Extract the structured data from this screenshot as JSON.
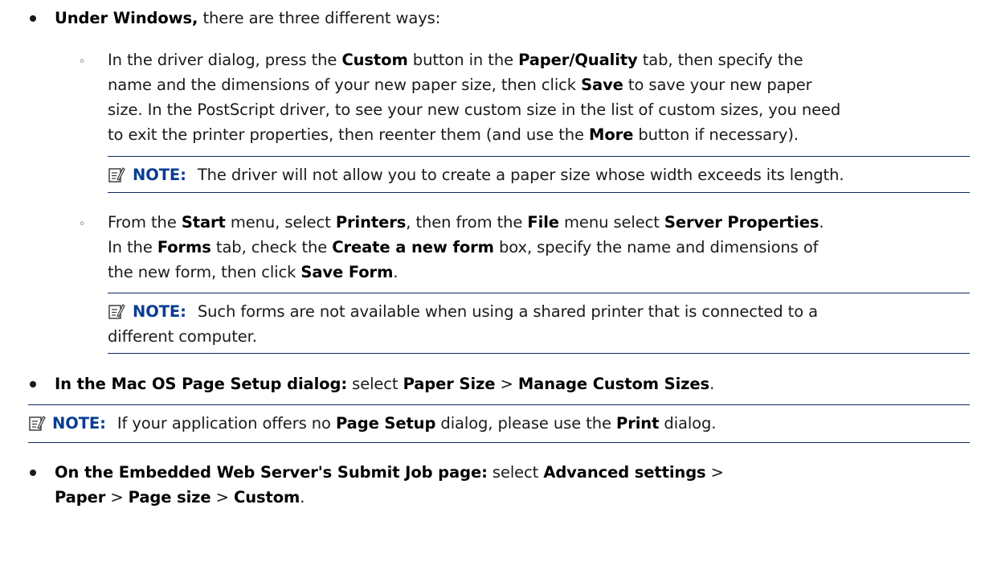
{
  "windows": {
    "lead": "Under Windows,",
    "rest": " there are three different ways:"
  },
  "w1": {
    "l1a": "In the driver dialog, press the ",
    "l1b": "Custom",
    "l1c": " button in the ",
    "l1d": "Paper/Quality",
    "l1e": " tab, then specify the",
    "l2a": "name and the dimensions of your new paper size, then click ",
    "l2b": "Save",
    "l2c": " to save your new paper",
    "l3": "size. In the PostScript driver, to see your new custom size in the list of custom sizes, you need",
    "l4a": "to exit the printer properties, then reenter them (and use the ",
    "l4b": "More",
    "l4c": " button if necessary)."
  },
  "note1": {
    "label": "NOTE:",
    "text": "The driver will not allow you to create a paper size whose width exceeds its length."
  },
  "w2": {
    "l1a": "From the ",
    "l1b": "Start",
    "l1c": " menu, select ",
    "l1d": "Printers",
    "l1e": ", then from the ",
    "l1f": "File",
    "l1g": " menu select ",
    "l1h": "Server Properties",
    "l1i": ".",
    "l2a": "In the ",
    "l2b": "Forms",
    "l2c": " tab, check the ",
    "l2d": "Create a new form",
    "l2e": " box, specify the name and dimensions of",
    "l3a": "the new form, then click ",
    "l3b": "Save Form",
    "l3c": "."
  },
  "note2": {
    "label": "NOTE:",
    "l1": "Such forms are not available when using a shared printer that is connected to a",
    "l2": "different computer."
  },
  "mac": {
    "a": "In the Mac OS Page Setup dialog:",
    "b": " select ",
    "c": "Paper Size",
    "d": " > ",
    "e": "Manage Custom Sizes",
    "f": "."
  },
  "note3": {
    "label": "NOTE:",
    "a": "If your application offers no ",
    "b": "Page Setup",
    "c": " dialog, please use the ",
    "d": "Print",
    "e": " dialog."
  },
  "ews": {
    "a": "On the Embedded Web Server's Submit Job page:",
    "b": " select ",
    "c": "Advanced settings",
    "d": " >",
    "e": "Paper",
    "f": " > ",
    "g": "Page size",
    "h": " > ",
    "i": "Custom",
    "j": "."
  },
  "icons": {
    "note": "note-pencil-icon",
    "bullet": "bullet-dot",
    "sub_bullet": "hollow-circle-bullet"
  },
  "colors": {
    "note_label": "#0a3d91",
    "rule": "#0f2a5f"
  }
}
